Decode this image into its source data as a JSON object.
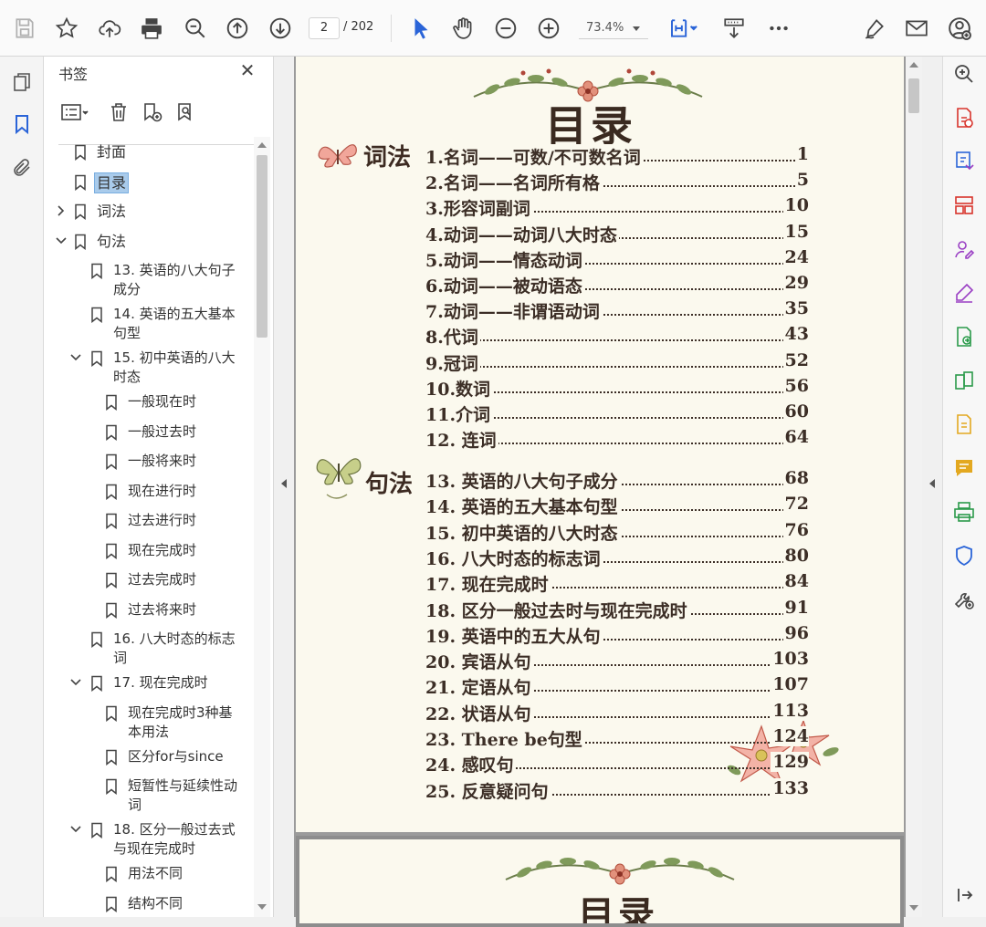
{
  "toolbar": {
    "current_page": "2",
    "total_pages": "/ 202",
    "zoom": "73.4%",
    "icons": [
      "save-icon",
      "bookmark-star-icon",
      "cloud-upload-icon",
      "print-icon",
      "zoom-search-icon",
      "page-up-icon",
      "page-down-icon",
      "select-cursor-icon",
      "hand-tool-icon",
      "zoom-out-icon",
      "zoom-in-icon",
      "fit-page-icon",
      "scroll-mode-icon",
      "more-icon",
      "sign-icon",
      "email-icon",
      "account-icon"
    ]
  },
  "bookmarks": {
    "title": "书签",
    "items": [
      {
        "label": "封面",
        "level": 0,
        "expand": "none"
      },
      {
        "label": "目录",
        "level": 0,
        "expand": "none",
        "selected": true
      },
      {
        "label": "词法",
        "level": 0,
        "expand": "collapsed"
      },
      {
        "label": "句法",
        "level": 0,
        "expand": "expanded"
      },
      {
        "label": "13. 英语的八大句子",
        "label2": "成分",
        "level": 1,
        "expand": "none"
      },
      {
        "label": "14. 英语的五大基本",
        "label2": "句型",
        "level": 1,
        "expand": "none"
      },
      {
        "label": "15. 初中英语的八大",
        "label2": "时态",
        "level": 1,
        "expand": "expanded"
      },
      {
        "label": "一般现在时",
        "level": 2,
        "expand": "none"
      },
      {
        "label": "一般过去时",
        "level": 2,
        "expand": "none"
      },
      {
        "label": "一般将来时",
        "level": 2,
        "expand": "none"
      },
      {
        "label": "现在进行时",
        "level": 2,
        "expand": "none"
      },
      {
        "label": "过去进行时",
        "level": 2,
        "expand": "none"
      },
      {
        "label": "现在完成时",
        "level": 2,
        "expand": "none"
      },
      {
        "label": "过去完成时",
        "level": 2,
        "expand": "none"
      },
      {
        "label": "过去将来时",
        "level": 2,
        "expand": "none"
      },
      {
        "label": "16. 八大时态的标志",
        "label2": "词",
        "level": 1,
        "expand": "none"
      },
      {
        "label": "17. 现在完成时",
        "level": 1,
        "expand": "expanded"
      },
      {
        "label": "现在完成时3种基",
        "label2": "本用法",
        "level": 2,
        "expand": "none"
      },
      {
        "label": "区分for与since",
        "level": 2,
        "expand": "none"
      },
      {
        "label": "短暂性与延续性动",
        "label2": "词",
        "level": 2,
        "expand": "none"
      },
      {
        "label": "18. 区分一般过去式",
        "label2": "与现在完成时",
        "level": 1,
        "expand": "expanded"
      },
      {
        "label": "用法不同",
        "level": 2,
        "expand": "none"
      },
      {
        "label": "结构不同",
        "level": 2,
        "expand": "none"
      }
    ]
  },
  "document": {
    "page_title": "目录",
    "next_page_title": "目录",
    "sections": [
      {
        "label": "词法",
        "entries": [
          {
            "title": "1.名词——可数/不可数名词",
            "page": "1"
          },
          {
            "title": "2.名词——名词所有格",
            "page": "5"
          },
          {
            "title": "3.形容词副词",
            "page": "10"
          },
          {
            "title": "4.动词——动词八大时态",
            "page": "15"
          },
          {
            "title": "5.动词——情态动词",
            "page": "24"
          },
          {
            "title": "6.动词——被动语态",
            "page": "29"
          },
          {
            "title": "7.动词——非谓语动词",
            "page": "35"
          },
          {
            "title": "8.代词",
            "page": "43"
          },
          {
            "title": "9.冠词",
            "page": "52"
          },
          {
            "title": "10.数词",
            "page": "56"
          },
          {
            "title": "11.介词",
            "page": "60"
          },
          {
            "title": "12. 连词",
            "page": "64"
          }
        ]
      },
      {
        "label": "句法",
        "entries": [
          {
            "title": "13. 英语的八大句子成分",
            "page": "68"
          },
          {
            "title": "14. 英语的五大基本句型",
            "page": "72"
          },
          {
            "title": "15. 初中英语的八大时态",
            "page": "76"
          },
          {
            "title": "16. 八大时态的标志词",
            "page": "80"
          },
          {
            "title": "17. 现在完成时",
            "page": "84"
          },
          {
            "title": "18. 区分一般过去时与现在完成时",
            "page": "91"
          },
          {
            "title": "19. 英语中的五大从句",
            "page": "96"
          },
          {
            "title": "20. 宾语从句",
            "page": "103"
          },
          {
            "title": "21. 定语从句",
            "page": "107"
          },
          {
            "title": "22. 状语从句",
            "page": "113"
          },
          {
            "title": "23. There be句型",
            "page": "124"
          },
          {
            "title": "24. 感叹句",
            "page": "129"
          },
          {
            "title": "25. 反意疑问句",
            "page": "133"
          }
        ]
      }
    ]
  },
  "colors": {
    "selection": "#a9cbeb",
    "tool_red": "#d8342c",
    "tool_blue": "#2a64d8",
    "tool_purple": "#9a3fc4",
    "tool_green": "#2a9a4a",
    "tool_yellow": "#e3a820",
    "page_bg": "#fbf9ee"
  }
}
